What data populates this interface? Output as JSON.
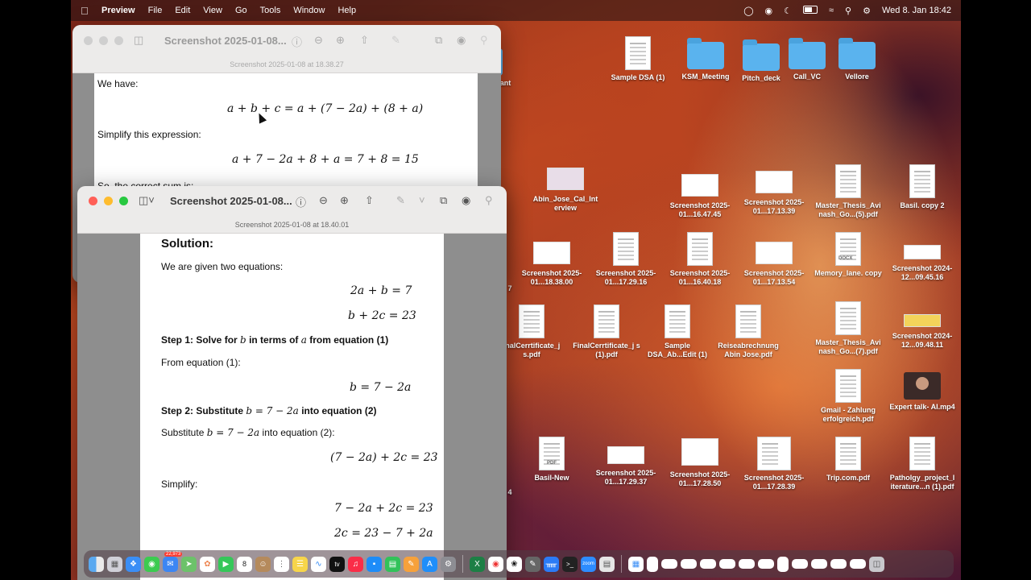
{
  "menubar": {
    "app": "Preview",
    "items": [
      "File",
      "Edit",
      "View",
      "Go",
      "Tools",
      "Window",
      "Help"
    ],
    "clock": "Wed 8. Jan  18:42"
  },
  "back_window": {
    "title": "Screenshot 2025-01-08...",
    "subtitle": "Screenshot 2025-01-08 at 18.38.27",
    "line1": "We have:",
    "eq1": "a + b + c = a + (7 − 2a) + (8 + a)",
    "line2": "Simplify this expression:",
    "eq2": "a + 7 − 2a + 8 + a = 7 + 8 = 15",
    "line3": "So, the correct sum is:"
  },
  "front_window": {
    "title": "Screenshot 2025-01-08...",
    "subtitle": "Screenshot 2025-01-08 at 18.40.01",
    "heading": "Solution:",
    "intro": "We are given two equations:",
    "eq1": "2a + b = 7",
    "eq2": "b + 2c = 23",
    "step1_a": "Step 1: Solve for",
    "step1_b": "b",
    "step1_c": "in terms of",
    "step1_d": "a",
    "step1_e": "from equation (1)",
    "from_eq1": "From equation (1):",
    "eq3": "b = 7 − 2a",
    "step2_a": "Step 2: Substitute",
    "step2_b": "b = 7 − 2a",
    "step2_c": "into equation (2)",
    "subst_a": "Substitute",
    "subst_b": "b = 7 − 2a",
    "subst_c": "into equation (2):",
    "eq4": "(7 − 2a) + 2c = 23",
    "simplify": "Simplify:",
    "eq5": "7 − 2a + 2c = 23",
    "eq6": "2c = 23 − 7 + 2a"
  },
  "desktop": {
    "folders": [
      {
        "label": "KSM_Meeting"
      },
      {
        "label": "Pitch_deck"
      },
      {
        "label": "Call_VC"
      },
      {
        "label": "Vellore"
      }
    ],
    "partial_grant": "grant",
    "sample_dsa": "Sample DSA (1)",
    "row2": [
      {
        "label": "Abin_Jose_Cal_Int erview"
      },
      {
        "label": "Screenshot 2025-01...16.47.45"
      },
      {
        "label": "Screenshot 2025-01...17.13.39"
      },
      {
        "label": "Master_Thesis_Avi nash_Go...(5).pdf"
      },
      {
        "label": "Basil. copy 2"
      }
    ],
    "row3": [
      {
        "label": "Screenshot 2025-01...18.38.00"
      },
      {
        "label": "Screenshot 2025-01...17.29.16"
      },
      {
        "label": "Screenshot 2025-01...16.40.18"
      },
      {
        "label": "Screenshot 2025-01...17.13.54"
      },
      {
        "label": "Memory_lane. copy"
      },
      {
        "label": "Screenshot 2024-12...09.45.16"
      }
    ],
    "row3_partial": "7",
    "row4": [
      {
        "label": "inalCerrtificate_j s.pdf"
      },
      {
        "label": "FinalCerrtificate_j s (1).pdf"
      },
      {
        "label": "Sample DSA_Ab...Edit (1)"
      },
      {
        "label": "Reiseabrechnung Abin Jose.pdf"
      },
      {
        "label": "Master_Thesis_Avi nash_Go...(7).pdf"
      },
      {
        "label": "Screenshot 2024-12...09.48.11"
      }
    ],
    "row5": [
      {
        "label": "Gmail - Zahlung erfolgreich.pdf"
      },
      {
        "label": "Expert talk- AI.mp4"
      }
    ],
    "row6": [
      {
        "label": "Basil-New"
      },
      {
        "label": "Screenshot 2025-01...17.29.37"
      },
      {
        "label": "Screenshot 2025-01...17.28.50"
      },
      {
        "label": "Screenshot 2025-01...17.28.39"
      },
      {
        "label": "Trip.com.pdf"
      },
      {
        "label": "Patholgy_project_l iterature...n (1).pdf"
      }
    ],
    "row6_partial": "4",
    "docx_tag": "DOCX",
    "pdf_tag": "PDF"
  },
  "dock": {
    "calendar_day": "8",
    "mail_badge": "22,973",
    "tv_label": "tv",
    "zoom_label": "zoom"
  }
}
